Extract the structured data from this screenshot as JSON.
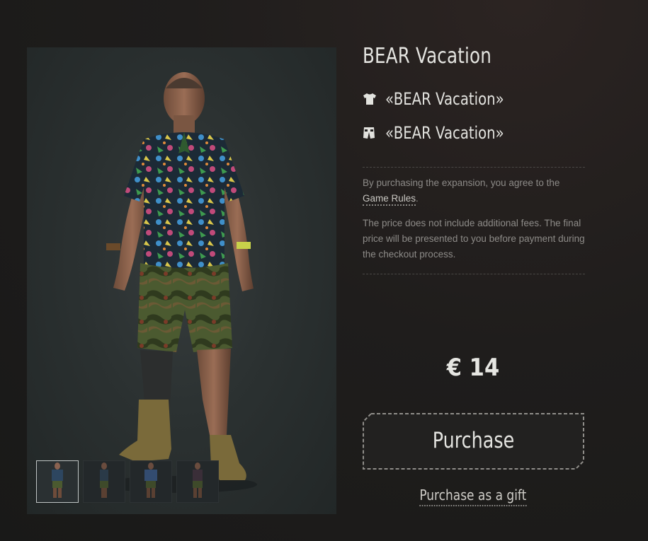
{
  "product": {
    "title": "BEAR Vacation",
    "items": [
      {
        "icon": "tshirt-icon",
        "label": "«BEAR Vacation»"
      },
      {
        "icon": "shorts-icon",
        "label": "«BEAR Vacation»"
      }
    ]
  },
  "legal": {
    "agreement_text": "By purchasing the expansion, you agree to the",
    "rules_link": "Game Rules",
    "rules_suffix": ".",
    "price_notice": "The price does not include additional fees. The final price will be presented to you before payment during the checkout process."
  },
  "price": "€ 14",
  "actions": {
    "purchase_label": "Purchase",
    "gift_label": "Purchase as a gift"
  },
  "gallery": {
    "thumbnails": [
      "front-view",
      "side-view",
      "back-view",
      "alt-view"
    ],
    "active_index": 0
  },
  "colors": {
    "background": "#1f1d1c",
    "preview_bg": "#2b3131",
    "text": "#e4e4e0",
    "muted_text": "#8d8b88",
    "dashed_border": "#8a8885"
  }
}
